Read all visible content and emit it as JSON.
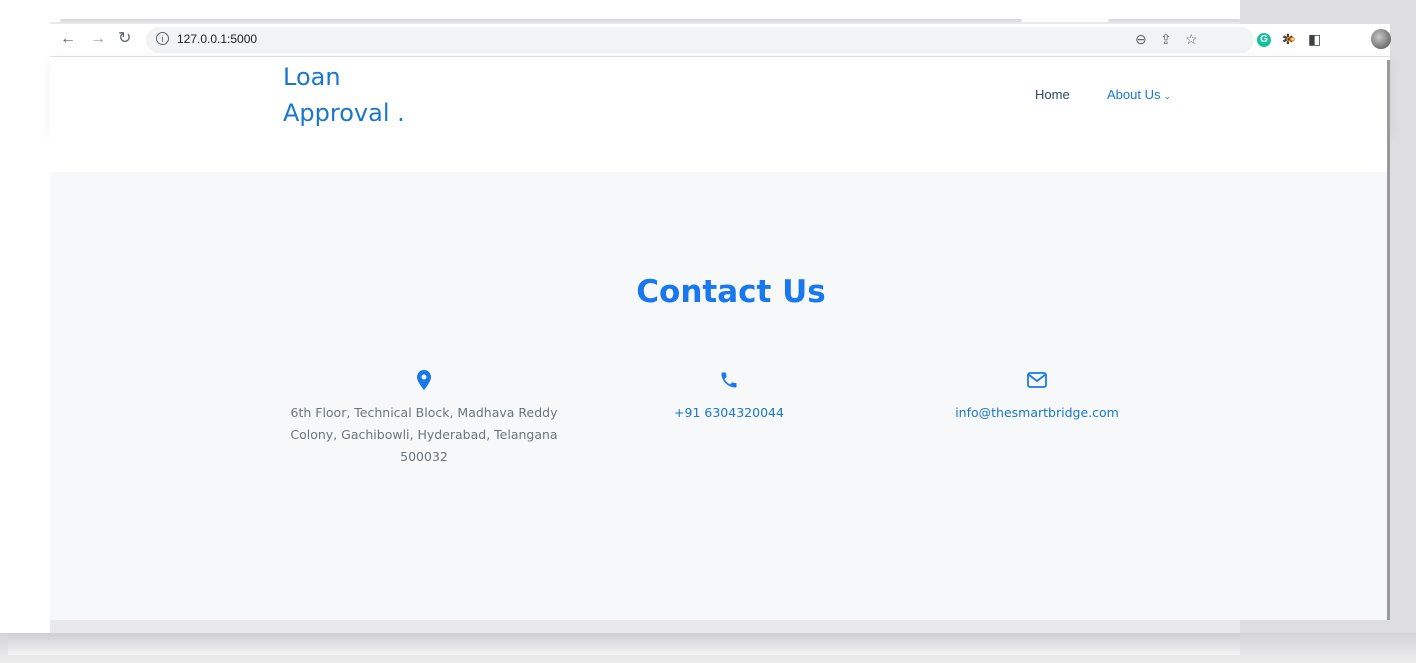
{
  "browser": {
    "url": "127.0.0.1:5000",
    "nav_icons": [
      "back-arrow-icon",
      "forward-arrow-icon",
      "reload-icon"
    ],
    "toolbar_icons": [
      "zoom-icon",
      "share-icon",
      "bookmark-star-icon",
      "grammarly-icon",
      "extension-icon",
      "puzzle-icon",
      "side-panel-icon",
      "avatar"
    ]
  },
  "header": {
    "brand_line1": "Loan",
    "brand_line2": "Approval .",
    "nav": {
      "home": "Home",
      "about": "About Us",
      "about_chevron": "⌄"
    }
  },
  "contact": {
    "title": "Contact Us",
    "address": "6th Floor, Technical Block, Madhava Reddy Colony, Gachibowli, Hyderabad, Telangana 500032",
    "phone": "+91 6304320044",
    "email": "info@thesmartbridge.com"
  },
  "colors": {
    "brand": "#1977cc",
    "title": "#1977f0",
    "section_bg": "#f6f8fa"
  }
}
